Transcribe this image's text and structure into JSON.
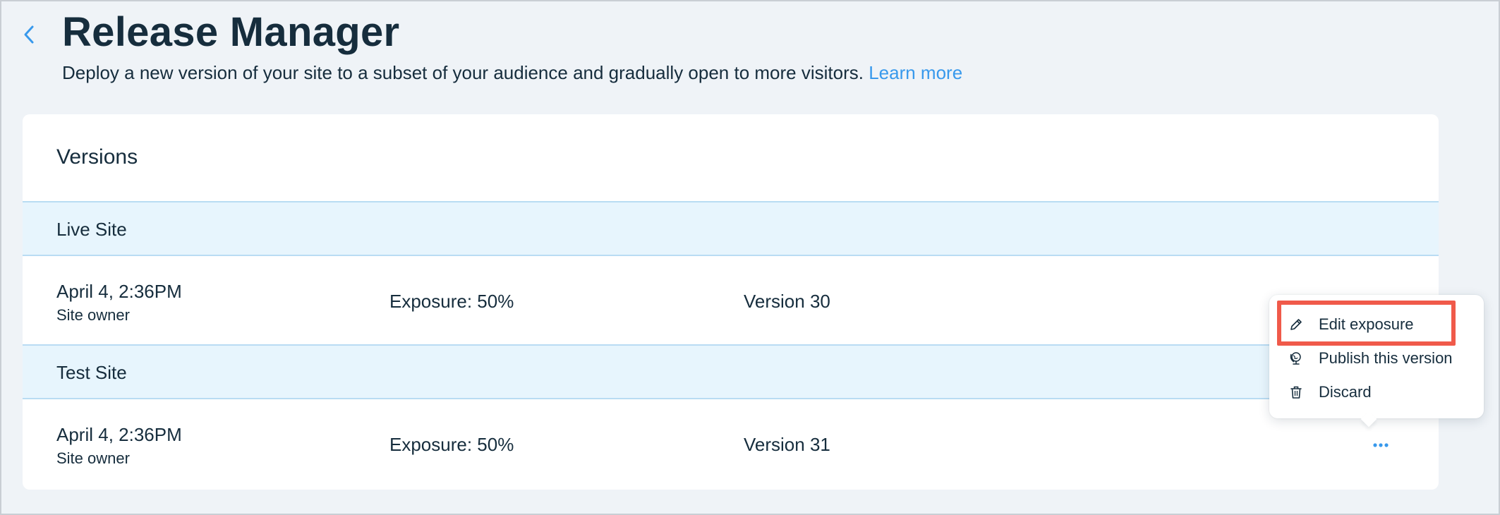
{
  "header": {
    "title": "Release Manager",
    "subtitle": "Deploy a new version of your site to a subset of your audience and gradually open to more visitors.",
    "learn_more": "Learn more"
  },
  "card": {
    "title": "Versions",
    "sections": [
      {
        "label": "Live Site",
        "date": "April 4, 2:36PM",
        "owner": "Site owner",
        "exposure": "Exposure: 50%",
        "version": "Version 30"
      },
      {
        "label": "Test Site",
        "date": "April 4, 2:36PM",
        "owner": "Site owner",
        "exposure": "Exposure: 50%",
        "version": "Version 31"
      }
    ]
  },
  "menu": {
    "items": [
      {
        "label": "Edit exposure",
        "icon": "pencil-icon"
      },
      {
        "label": "Publish this version",
        "icon": "globe-icon"
      },
      {
        "label": "Discard",
        "icon": "trash-icon"
      }
    ],
    "highlighted": "Edit exposure"
  },
  "colors": {
    "accent": "#3899ec",
    "text": "#162d3d",
    "section_bg": "#e7f5fd",
    "highlight": "#f05a4a",
    "page_bg": "#eff3f7"
  }
}
